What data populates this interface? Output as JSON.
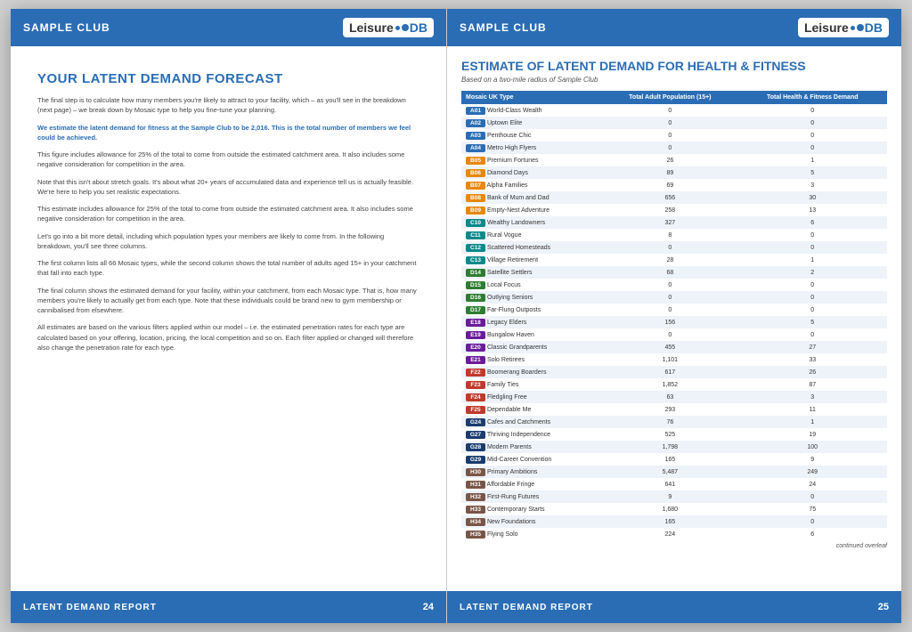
{
  "left_page": {
    "header": {
      "club_name": "SAMPLE CLUB",
      "logo_leisure": "Leisure",
      "logo_db": "DB"
    },
    "footer": {
      "report_name": "LATENT DEMAND REPORT",
      "page_number": "24"
    },
    "title": "YOUR LATENT DEMAND FORECAST",
    "paragraphs": [
      "The final step is to calculate how many members you're likely to attract to your facility, which – as you'll see in the breakdown (next page) – we break down by Mosaic type to help you fine-tune your planning.",
      "We estimate the latent demand for fitness at the Sample Club to be 2,016. This is the total number of members we feel could be achieved.",
      "This figure includes allowance for 25% of the total to come from outside the estimated catchment area. It also includes some negative consideration for competition in the area.",
      "Note that this isn't about stretch goals. It's about what 20+ years of accumulated data and experience tell us is actually feasible. We're here to help you set realistic expectations.",
      "This estimate includes allowance for 25% of the total to come from outside the estimated catchment area. It also includes some negative consideration for competition in the area.",
      "Let's go into a bit more detail, including which population types your members are likely to come from. In the following breakdown, you'll see three columns.",
      "The first column lists all 66 Mosaic types, while the second column shows the total number of adults aged 15+ in your catchment that fall into each type.",
      "The final column shows the estimated demand for your facility, within your catchment, from each Mosaic type. That is, how many members you're likely to actually get from each type. Note that these individuals could be brand new to gym membership or cannibalised from elsewhere.",
      "All estimates are based on the various filters applied within our model – i.e. the estimated penetration rates for each type are calculated based on your offering, location, pricing, the local competition and so on. Each filter applied or changed will therefore also change the penetration rate for each type."
    ]
  },
  "right_page": {
    "header": {
      "club_name": "SAMPLE CLUB",
      "logo_leisure": "Leisure",
      "logo_db": "DB"
    },
    "footer": {
      "report_name": "LATENT DEMAND REPORT",
      "page_number": "25"
    },
    "title": "ESTIMATE OF LATENT DEMAND FOR HEALTH & FITNESS",
    "subtitle": "Based on a two-mile radius of Sample Club",
    "table": {
      "columns": [
        "Mosaic UK Type",
        "Total Adult Population (15+)",
        "Total Health & Fitness Demand"
      ],
      "rows": [
        {
          "code": "A01",
          "type": "World-Class Wealth",
          "population": "0",
          "demand": "0",
          "color": "blue"
        },
        {
          "code": "A02",
          "type": "Uptown Elite",
          "population": "0",
          "demand": "0",
          "color": "blue"
        },
        {
          "code": "A03",
          "type": "Penthouse Chic",
          "population": "0",
          "demand": "0",
          "color": "blue"
        },
        {
          "code": "A04",
          "type": "Metro High Flyers",
          "population": "0",
          "demand": "0",
          "color": "blue"
        },
        {
          "code": "B05",
          "type": "Premium Fortunes",
          "population": "26",
          "demand": "1",
          "color": "orange"
        },
        {
          "code": "B06",
          "type": "Diamond Days",
          "population": "89",
          "demand": "5",
          "color": "orange"
        },
        {
          "code": "B07",
          "type": "Alpha Families",
          "population": "69",
          "demand": "3",
          "color": "orange"
        },
        {
          "code": "B08",
          "type": "Bank of Mum and Dad",
          "population": "656",
          "demand": "30",
          "color": "orange"
        },
        {
          "code": "B09",
          "type": "Empty-Nest Adventure",
          "population": "258",
          "demand": "13",
          "color": "orange"
        },
        {
          "code": "C10",
          "type": "Wealthy Landowners",
          "population": "327",
          "demand": "6",
          "color": "teal"
        },
        {
          "code": "C11",
          "type": "Rural Vogue",
          "population": "8",
          "demand": "0",
          "color": "teal"
        },
        {
          "code": "C12",
          "type": "Scattered Homesteads",
          "population": "0",
          "demand": "0",
          "color": "teal"
        },
        {
          "code": "C13",
          "type": "Village Retirement",
          "population": "28",
          "demand": "1",
          "color": "teal"
        },
        {
          "code": "D14",
          "type": "Satellite Settlers",
          "population": "68",
          "demand": "2",
          "color": "green"
        },
        {
          "code": "D15",
          "type": "Local Focus",
          "population": "0",
          "demand": "0",
          "color": "green"
        },
        {
          "code": "D16",
          "type": "Outlying Seniors",
          "population": "0",
          "demand": "0",
          "color": "green"
        },
        {
          "code": "D17",
          "type": "Far-Flung Outposts",
          "population": "0",
          "demand": "0",
          "color": "green"
        },
        {
          "code": "E18",
          "type": "Legacy Elders",
          "population": "156",
          "demand": "5",
          "color": "purple"
        },
        {
          "code": "E19",
          "type": "Bungalow Haven",
          "population": "0",
          "demand": "0",
          "color": "purple"
        },
        {
          "code": "E20",
          "type": "Classic Grandparents",
          "population": "455",
          "demand": "27",
          "color": "purple"
        },
        {
          "code": "E21",
          "type": "Solo Retirees",
          "population": "1,101",
          "demand": "33",
          "color": "purple"
        },
        {
          "code": "F22",
          "type": "Boomerang Boarders",
          "population": "617",
          "demand": "26",
          "color": "red"
        },
        {
          "code": "F23",
          "type": "Family Ties",
          "population": "1,852",
          "demand": "87",
          "color": "red"
        },
        {
          "code": "F24",
          "type": "Fledgling Free",
          "population": "63",
          "demand": "3",
          "color": "red"
        },
        {
          "code": "F25",
          "type": "Dependable Me",
          "population": "293",
          "demand": "11",
          "color": "red"
        },
        {
          "code": "G24",
          "type": "Cafes and Catchments",
          "population": "76",
          "demand": "1",
          "color": "dark-blue"
        },
        {
          "code": "G27",
          "type": "Thriving Independence",
          "population": "525",
          "demand": "19",
          "color": "dark-blue"
        },
        {
          "code": "G28",
          "type": "Modern Parents",
          "population": "1,798",
          "demand": "100",
          "color": "dark-blue"
        },
        {
          "code": "G29",
          "type": "Mid-Career Convention",
          "population": "165",
          "demand": "9",
          "color": "dark-blue"
        },
        {
          "code": "H30",
          "type": "Primary Ambitions",
          "population": "5,487",
          "demand": "249",
          "color": "brown"
        },
        {
          "code": "H31",
          "type": "Affordable Fringe",
          "population": "641",
          "demand": "24",
          "color": "brown"
        },
        {
          "code": "H32",
          "type": "First-Rung Futures",
          "population": "9",
          "demand": "0",
          "color": "brown"
        },
        {
          "code": "H33",
          "type": "Contemporary Starts",
          "population": "1,680",
          "demand": "75",
          "color": "brown"
        },
        {
          "code": "H34",
          "type": "New Foundations",
          "population": "165",
          "demand": "0",
          "color": "brown"
        },
        {
          "code": "H35",
          "type": "Flying Solo",
          "population": "224",
          "demand": "6",
          "color": "brown"
        }
      ]
    },
    "continued_text": "continued overleaf"
  }
}
